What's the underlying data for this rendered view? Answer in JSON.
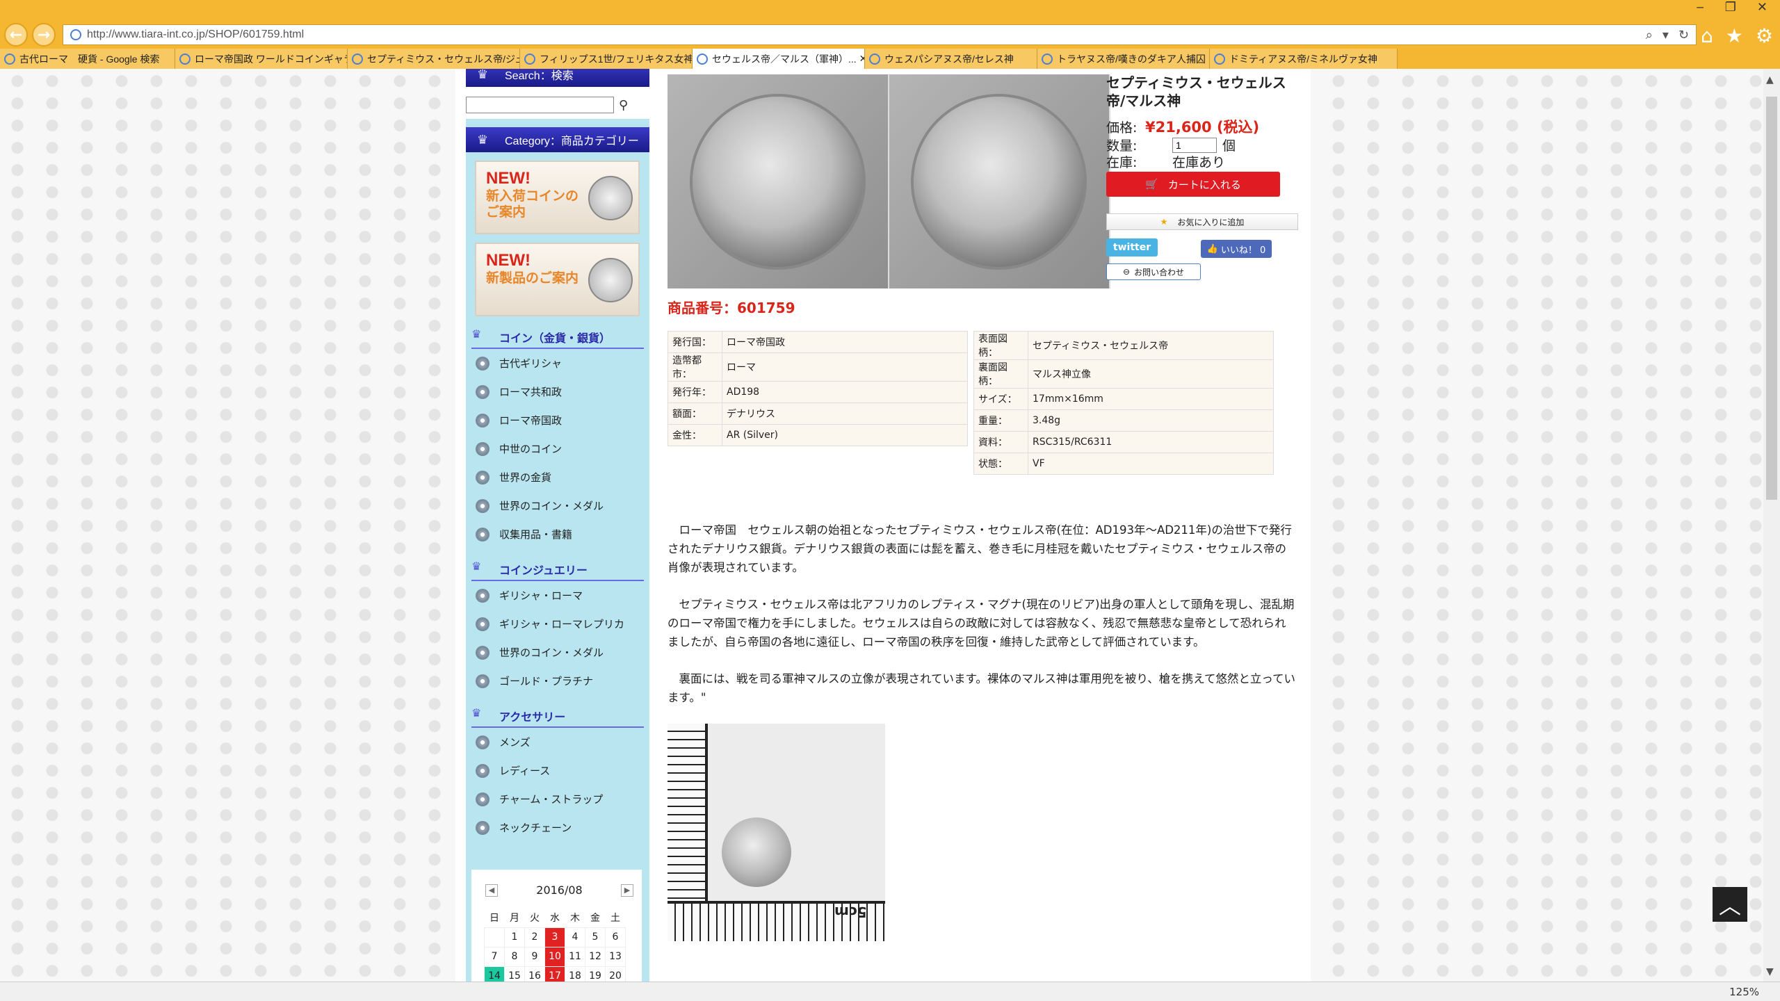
{
  "browser": {
    "url": "http://www.tiara-int.co.jp/SHOP/601759.html",
    "zoom": "125%",
    "tabs": [
      {
        "label": "古代ローマ　硬貨 - Google 検索",
        "active": false,
        "w": 252
      },
      {
        "label": "ローマ帝国政 ワールドコインギャラ...",
        "active": false,
        "w": 248
      },
      {
        "label": "セプティミウス・セウェルス帝/ジュピ...",
        "active": false,
        "w": 248
      },
      {
        "label": "フィリップス1世/フェリキタス女神",
        "active": false,
        "w": 248
      },
      {
        "label": "セウェルス帝／マルス（軍神）...",
        "active": true,
        "w": 248
      },
      {
        "label": "ウェスパシアヌス帝/セレス神",
        "active": false,
        "w": 248
      },
      {
        "label": "トラヤヌス帝/嘆きのダキア人捕囚",
        "active": false,
        "w": 248
      },
      {
        "label": "ドミティアヌス帝/ミネルヴァ女神",
        "active": false,
        "w": 270
      }
    ]
  },
  "sidebar": {
    "search_head": "Search：検索",
    "category_head": "Category：商品カテゴリー",
    "banner1": {
      "new": "NEW!",
      "line1": "新入荷コインの",
      "line2": "ご案内"
    },
    "banner2": {
      "new": "NEW!",
      "line1": "新製品のご案内"
    },
    "groups": [
      {
        "title": "コイン（金貨・銀貨）",
        "items": [
          "古代ギリシャ",
          "ローマ共和政",
          "ローマ帝国政",
          "中世のコイン",
          "世界の金貨",
          "世界のコイン・メダル",
          "収集用品・書籍"
        ]
      },
      {
        "title": "コインジュエリー",
        "items": [
          "ギリシャ・ローマ",
          "ギリシャ・ローマレプリカ",
          "世界のコイン・メダル",
          "ゴールド・プラチナ"
        ]
      },
      {
        "title": "アクセサリー",
        "items": [
          "メンズ",
          "レディース",
          "チャーム・ストラップ",
          "ネックチェーン"
        ]
      }
    ],
    "calendar": {
      "month": "2016/08",
      "weekdays": [
        "日",
        "月",
        "火",
        "水",
        "木",
        "金",
        "土"
      ],
      "weeks": [
        [
          "",
          "1",
          "2",
          "3",
          "4",
          "5",
          "6"
        ],
        [
          "7",
          "8",
          "9",
          "10",
          "11",
          "12",
          "13"
        ],
        [
          "14",
          "15",
          "16",
          "17",
          "18",
          "19",
          "20"
        ]
      ],
      "red_days": [
        "3",
        "10",
        "17"
      ],
      "green_days": [
        "14"
      ]
    }
  },
  "product": {
    "title": "セプティミウス・セウェルス帝/マルス神",
    "price_label": "価格:",
    "price": "¥21,600 (税込)",
    "qty_label": "数量:",
    "qty_value": "1",
    "qty_unit": "個",
    "stock_label": "在庫:",
    "stock_value": "在庫あり",
    "cart_button": "カートに入れる",
    "fav_button": "お気に入りに追加",
    "twitter": "twitter",
    "like": "いいね！ 0",
    "inquiry": "お問い合わせ",
    "number": "商品番号：601759",
    "spec_left": [
      [
        "発行国：",
        "ローマ帝国政"
      ],
      [
        "造幣都市：",
        "ローマ"
      ],
      [
        "発行年：",
        "AD198"
      ],
      [
        "額面：",
        "デナリウス"
      ],
      [
        "金性：",
        "AR (Silver)"
      ]
    ],
    "spec_right": [
      [
        "表面図柄：",
        "セプティミウス・セウェルス帝"
      ],
      [
        "裏面図柄：",
        "マルス神立像"
      ],
      [
        "サイズ：",
        "17mm×16mm"
      ],
      [
        "重量：",
        "3.48g"
      ],
      [
        "資料：",
        "RSC315/RC6311"
      ],
      [
        "状態：",
        "VF"
      ]
    ],
    "description": [
      "ローマ帝国　セウェルス朝の始祖となったセプティミウス・セウェルス帝(在位：AD193年～AD211年)の治世下で発行されたデナリウス銀貨。デナリウス銀貨の表面には髭を蓄え、巻き毛に月桂冠を戴いたセプティミウス・セウェルス帝の肖像が表現されています。",
      "セプティミウス・セウェルス帝は北アフリカのレプティス・マグナ(現在のリビア)出身の軍人として頭角を現し、混乱期のローマ帝国で権力を手にしました。セウェルスは自らの政敵に対しては容赦なく、残忍で無慈悲な皇帝として恐れられましたが、自ら帝国の各地に遠征し、ローマ帝国の秩序を回復・維持した武帝として評価されています。",
      "裏面には、戦を司る軍神マルスの立像が表現されています。裸体のマルス神は軍用兜を被り、槍を携えて悠然と立っています。\""
    ],
    "scale_label": "5cm"
  }
}
